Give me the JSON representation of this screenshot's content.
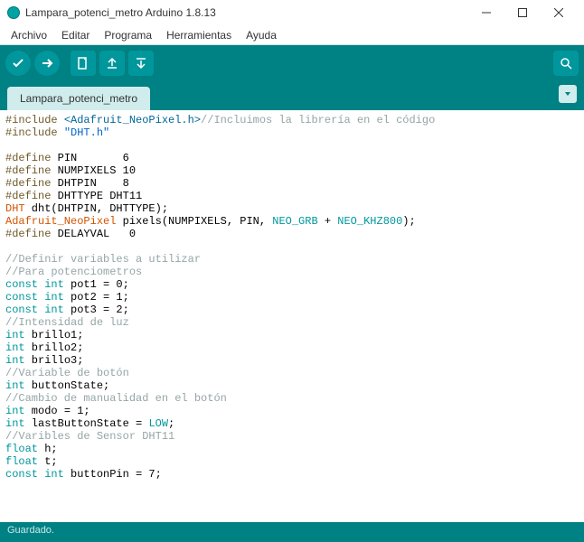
{
  "window": {
    "title": "Lampara_potenci_metro Arduino 1.8.13"
  },
  "menu": {
    "items": [
      "Archivo",
      "Editar",
      "Programa",
      "Herramientas",
      "Ayuda"
    ]
  },
  "toolbar": {
    "verify": "verify",
    "upload": "upload",
    "new": "new",
    "open": "open",
    "save": "save",
    "monitor": "serial-monitor"
  },
  "tab": {
    "name": "Lampara_potenci_metro"
  },
  "code": {
    "lines": [
      {
        "t": [
          [
            "pre",
            "#include "
          ],
          [
            "angled",
            "<Adafruit_NeoPixel.h>"
          ],
          [
            "comment",
            "//Incluimos la librería en el código"
          ]
        ]
      },
      {
        "t": [
          [
            "pre",
            "#include "
          ],
          [
            "quoted",
            "\"DHT.h\""
          ]
        ]
      },
      {
        "t": []
      },
      {
        "t": [
          [
            "pre",
            "#define"
          ],
          [
            "plain",
            " PIN       6"
          ]
        ]
      },
      {
        "t": [
          [
            "pre",
            "#define"
          ],
          [
            "plain",
            " NUMPIXELS 10"
          ]
        ]
      },
      {
        "t": [
          [
            "pre",
            "#define"
          ],
          [
            "plain",
            " DHTPIN    8"
          ]
        ]
      },
      {
        "t": [
          [
            "pre",
            "#define"
          ],
          [
            "plain",
            " DHTTYPE DHT11"
          ]
        ]
      },
      {
        "t": [
          [
            "class",
            "DHT"
          ],
          [
            "plain",
            " dht(DHTPIN, DHTTYPE);"
          ]
        ]
      },
      {
        "t": [
          [
            "class",
            "Adafruit_NeoPixel"
          ],
          [
            "plain",
            " pixels(NUMPIXELS, PIN, "
          ],
          [
            "const",
            "NEO_GRB"
          ],
          [
            "plain",
            " + "
          ],
          [
            "const",
            "NEO_KHZ800"
          ],
          [
            "plain",
            ");"
          ]
        ]
      },
      {
        "t": [
          [
            "pre",
            "#define"
          ],
          [
            "plain",
            " DELAYVAL   0"
          ]
        ]
      },
      {
        "t": []
      },
      {
        "t": [
          [
            "comment",
            "//Definir variables a utilizar"
          ]
        ]
      },
      {
        "t": [
          [
            "comment",
            "//Para potenciometros"
          ]
        ]
      },
      {
        "t": [
          [
            "type",
            "const int"
          ],
          [
            "plain",
            " pot1 = 0;"
          ]
        ]
      },
      {
        "t": [
          [
            "type",
            "const int"
          ],
          [
            "plain",
            " pot2 = 1;"
          ]
        ]
      },
      {
        "t": [
          [
            "type",
            "const int"
          ],
          [
            "plain",
            " pot3 = 2;"
          ]
        ]
      },
      {
        "t": [
          [
            "comment",
            "//Intensidad de luz"
          ]
        ]
      },
      {
        "t": [
          [
            "type",
            "int"
          ],
          [
            "plain",
            " brillo1;"
          ]
        ]
      },
      {
        "t": [
          [
            "type",
            "int"
          ],
          [
            "plain",
            " brillo2;"
          ]
        ]
      },
      {
        "t": [
          [
            "type",
            "int"
          ],
          [
            "plain",
            " brillo3;"
          ]
        ]
      },
      {
        "t": [
          [
            "comment",
            "//Variable de botón"
          ]
        ]
      },
      {
        "t": [
          [
            "type",
            "int"
          ],
          [
            "plain",
            " buttonState;"
          ]
        ]
      },
      {
        "t": [
          [
            "comment",
            "//Cambio de manualidad en el botón"
          ]
        ]
      },
      {
        "t": [
          [
            "type",
            "int"
          ],
          [
            "plain",
            " modo = 1;"
          ]
        ]
      },
      {
        "t": [
          [
            "type",
            "int"
          ],
          [
            "plain",
            " lastButtonState = "
          ],
          [
            "const",
            "LOW"
          ],
          [
            "plain",
            ";"
          ]
        ]
      },
      {
        "t": [
          [
            "comment",
            "//Varibles de Sensor DHT11"
          ]
        ]
      },
      {
        "t": [
          [
            "type",
            "float"
          ],
          [
            "plain",
            " h;"
          ]
        ]
      },
      {
        "t": [
          [
            "type",
            "float"
          ],
          [
            "plain",
            " t;"
          ]
        ]
      },
      {
        "t": [
          [
            "type",
            "const int"
          ],
          [
            "plain",
            " buttonPin = 7;"
          ]
        ]
      }
    ]
  },
  "status": {
    "text": "Guardado."
  }
}
